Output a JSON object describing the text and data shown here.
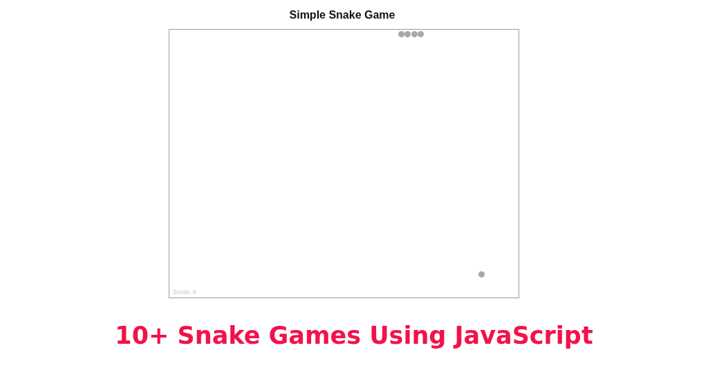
{
  "game": {
    "title": "Simple Snake Game",
    "score": "Score: 0"
  },
  "headline": "10+ Snake Games Using JavaScript"
}
